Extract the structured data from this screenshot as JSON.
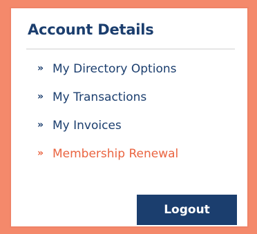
{
  "panel": {
    "title": "Account Details"
  },
  "menu": {
    "items": [
      {
        "label": "My Directory Options",
        "chevron": "»"
      },
      {
        "label": "My Transactions",
        "chevron": "»"
      },
      {
        "label": "My Invoices",
        "chevron": "»"
      },
      {
        "label": "Membership Renewal",
        "chevron": "»"
      }
    ]
  },
  "actions": {
    "logout_label": "Logout"
  },
  "colors": {
    "background": "#f4896b",
    "heading": "#1b3e6e",
    "link": "#1b3e6e",
    "highlight_link": "#ea6440",
    "button": "#1b3e6e"
  },
  "icons": {
    "menu_item_icon": "double-chevron-right-icon"
  }
}
